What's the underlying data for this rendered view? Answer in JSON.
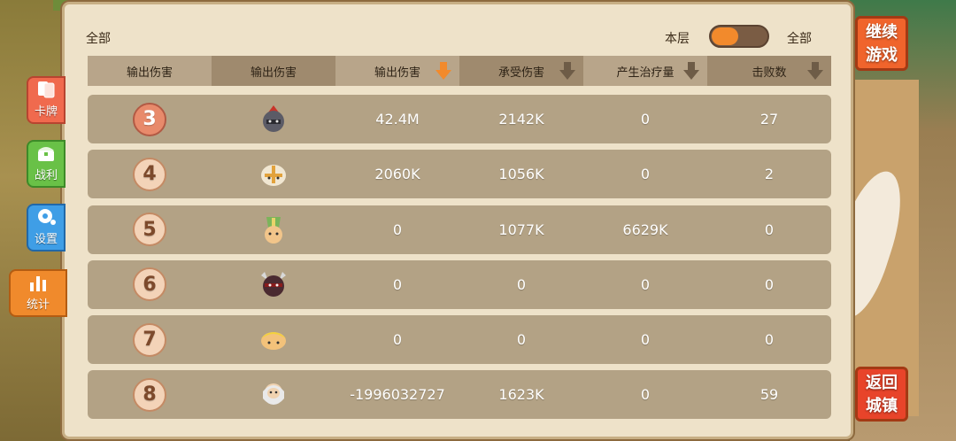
{
  "header": {
    "filter_left": "全部",
    "floor_label": "本层",
    "filter_right": "全部",
    "toggle_state": "left"
  },
  "columns": [
    {
      "label": "输出伤害",
      "sort_icon": ""
    },
    {
      "label": "输出伤害",
      "sort_icon": ""
    },
    {
      "label": "输出伤害",
      "sort_icon": "sort-down-arrow-icon-active"
    },
    {
      "label": "承受伤害",
      "sort_icon": "sort-down-arrow-icon"
    },
    {
      "label": "产生治疗量",
      "sort_icon": "sort-down-arrow-icon"
    },
    {
      "label": "击败数",
      "sort_icon": "sort-down-arrow-icon"
    }
  ],
  "rows": [
    {
      "rank": "3",
      "hero": "red-plumed-warrior-icon",
      "damage": "42.4M",
      "taken": "2142K",
      "healing": "0",
      "kills": "27"
    },
    {
      "rank": "4",
      "hero": "white-hooded-knight-icon",
      "damage": "2060K",
      "taken": "1056K",
      "healing": "0",
      "kills": "2"
    },
    {
      "rank": "5",
      "hero": "bishop-mitre-icon",
      "damage": "0",
      "taken": "1077K",
      "healing": "6629K",
      "kills": "0"
    },
    {
      "rank": "6",
      "hero": "horned-dark-warrior-icon",
      "damage": "0",
      "taken": "0",
      "healing": "0",
      "kills": "0"
    },
    {
      "rank": "7",
      "hero": "blonde-child-icon",
      "damage": "0",
      "taken": "0",
      "healing": "0",
      "kills": "0"
    },
    {
      "rank": "8",
      "hero": "white-bearded-sage-icon",
      "damage": "-1996032727",
      "taken": "1623K",
      "healing": "0",
      "kills": "59"
    }
  ],
  "side_tabs": {
    "cards": "卡牌",
    "loot": "战利",
    "settings": "设置",
    "stats": "统计"
  },
  "buttons": {
    "continue_line1": "继续",
    "continue_line2": "游戏",
    "back_line1": "返回",
    "back_line2": "城镇"
  },
  "colors": {
    "accent_orange": "#f28a2c",
    "panel_bg": "#eee2c9",
    "row_bg": "#b3a285"
  }
}
